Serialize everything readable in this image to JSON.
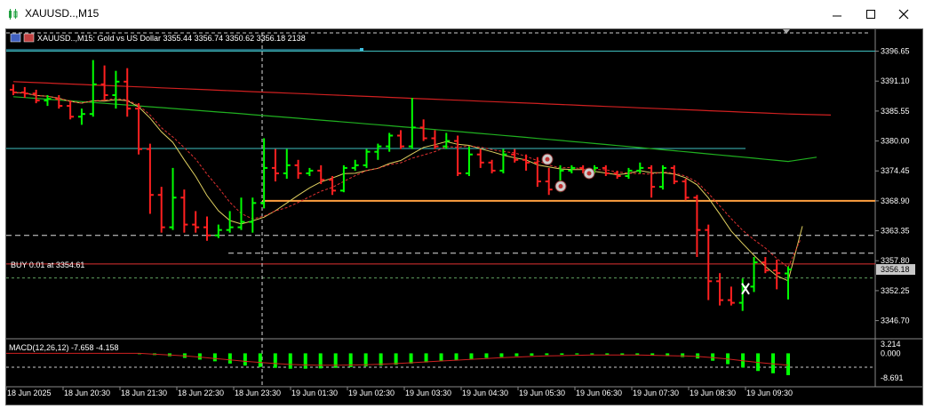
{
  "window": {
    "title": "XAUUSD..,M15",
    "minimize_icon": "minimize-icon",
    "maximize_icon": "maximize-icon",
    "close_icon": "close-icon"
  },
  "chart_header": {
    "text": "XAUUSD..,M15:  Gold vs US Dollar  3355.44 3356.74 3350.62 3356.18  2138"
  },
  "position_label": "BUY 0.01 at 3354.61",
  "macd_label": "MACD(12,26,12) -7.658 -4.158",
  "colors": {
    "background": "#000000",
    "bull": "#00ff00",
    "bear": "#ff2020",
    "grid": "#ffffff",
    "hline_cyan": "#40c0c0",
    "orange_line": "#ffa040",
    "ma_red": "#d02020",
    "ma_green": "#20b020",
    "ma_yellow": "#e0d060"
  },
  "chart_data": {
    "type": "candlestick",
    "title": "XAUUSD..,M15",
    "price_axis_ticks": [
      "3396.65",
      "3391.10",
      "3385.55",
      "3380.00",
      "3374.45",
      "3368.90",
      "3363.35",
      "3357.80",
      "3352.25",
      "3346.70"
    ],
    "price_axis_range": [
      3343.5,
      3400.2
    ],
    "current_price": "3356.18",
    "position_price": 3354.61,
    "horizontal_levels": [
      3396.65,
      3378.6,
      3368.9,
      3362.5,
      3359.2,
      3357.2
    ],
    "time_axis_labels": [
      "18 Jun 2025",
      "18 Jun 20:30",
      "18 Jun 21:30",
      "18 Jun 22:30",
      "18 Jun 23:30",
      "19 Jun 01:30",
      "19 Jun 02:30",
      "19 Jun 03:30",
      "19 Jun 04:30",
      "19 Jun 05:30",
      "19 Jun 06:30",
      "19 Jun 07:30",
      "19 Jun 08:30",
      "19 Jun 09:30"
    ],
    "candles": [
      [
        3389.5,
        3390.5,
        3388.5,
        3389.0
      ],
      [
        3389.0,
        3390.0,
        3388.0,
        3388.8
      ],
      [
        3388.8,
        3389.5,
        3387.0,
        3387.5
      ],
      [
        3387.5,
        3388.5,
        3386.5,
        3387.8
      ],
      [
        3387.8,
        3388.5,
        3386.0,
        3386.5
      ],
      [
        3386.5,
        3387.5,
        3384.0,
        3384.5
      ],
      [
        3384.5,
        3386.0,
        3383.0,
        3385.0
      ],
      [
        3385.0,
        3395.0,
        3384.5,
        3390.5
      ],
      [
        3390.5,
        3394.0,
        3387.5,
        3388.5
      ],
      [
        3388.5,
        3393.0,
        3386.0,
        3391.0
      ],
      [
        3391.0,
        3393.5,
        3384.5,
        3386.0
      ],
      [
        3386.0,
        3387.0,
        3377.5,
        3378.5
      ],
      [
        3378.5,
        3379.5,
        3366.5,
        3370.0
      ],
      [
        3370.0,
        3371.5,
        3363.0,
        3364.0
      ],
      [
        3364.0,
        3375.0,
        3363.5,
        3369.5
      ],
      [
        3369.5,
        3371.0,
        3363.0,
        3364.5
      ],
      [
        3364.5,
        3367.0,
        3363.0,
        3364.0
      ],
      [
        3364.0,
        3366.0,
        3361.5,
        3362.5
      ],
      [
        3362.5,
        3364.5,
        3362.0,
        3363.5
      ],
      [
        3363.5,
        3367.0,
        3363.0,
        3364.0
      ],
      [
        3364.0,
        3369.5,
        3363.5,
        3365.0
      ],
      [
        3365.0,
        3369.5,
        3363.0,
        3368.5
      ],
      [
        3368.5,
        3380.5,
        3367.5,
        3375.0
      ],
      [
        3375.0,
        3378.5,
        3372.5,
        3374.0
      ],
      [
        3374.0,
        3378.5,
        3373.0,
        3375.5
      ],
      [
        3375.5,
        3376.5,
        3373.0,
        3374.0
      ],
      [
        3374.0,
        3375.0,
        3373.5,
        3374.5
      ],
      [
        3374.5,
        3375.5,
        3372.0,
        3372.8
      ],
      [
        3372.8,
        3373.5,
        3370.0,
        3370.8
      ],
      [
        3370.8,
        3375.5,
        3370.5,
        3375.0
      ],
      [
        3375.0,
        3376.5,
        3374.5,
        3375.5
      ],
      [
        3375.5,
        3378.5,
        3375.0,
        3378.0
      ],
      [
        3378.0,
        3379.5,
        3376.5,
        3379.0
      ],
      [
        3379.0,
        3381.5,
        3378.0,
        3381.0
      ],
      [
        3381.0,
        3382.0,
        3378.5,
        3379.0
      ],
      [
        3379.0,
        3388.0,
        3378.5,
        3382.5
      ],
      [
        3382.5,
        3384.0,
        3380.0,
        3380.5
      ],
      [
        3380.5,
        3382.0,
        3378.5,
        3379.0
      ],
      [
        3379.0,
        3381.5,
        3378.5,
        3380.0
      ],
      [
        3380.0,
        3381.0,
        3373.5,
        3374.0
      ],
      [
        3374.0,
        3379.0,
        3373.5,
        3377.5
      ],
      [
        3377.5,
        3378.5,
        3375.0,
        3376.0
      ],
      [
        3376.0,
        3376.5,
        3374.0,
        3374.5
      ],
      [
        3374.5,
        3378.5,
        3374.0,
        3377.5
      ],
      [
        3377.5,
        3378.5,
        3376.0,
        3376.5
      ],
      [
        3376.5,
        3377.5,
        3374.5,
        3376.0
      ],
      [
        3376.0,
        3377.0,
        3371.5,
        3372.5
      ],
      [
        3372.5,
        3375.0,
        3370.0,
        3371.0
      ],
      [
        3371.0,
        3375.5,
        3370.5,
        3374.5
      ],
      [
        3374.5,
        3375.5,
        3374.0,
        3375.0
      ],
      [
        3375.0,
        3375.5,
        3374.0,
        3374.5
      ],
      [
        3374.5,
        3375.5,
        3374.0,
        3375.0
      ],
      [
        3375.0,
        3375.5,
        3373.5,
        3374.0
      ],
      [
        3374.0,
        3374.5,
        3373.0,
        3373.5
      ],
      [
        3373.5,
        3375.0,
        3373.0,
        3374.5
      ],
      [
        3374.5,
        3376.0,
        3374.0,
        3375.0
      ],
      [
        3375.0,
        3375.5,
        3369.5,
        3371.5
      ],
      [
        3371.5,
        3375.5,
        3371.0,
        3375.0
      ],
      [
        3375.0,
        3375.5,
        3372.0,
        3372.5
      ],
      [
        3372.5,
        3373.0,
        3369.0,
        3369.5
      ],
      [
        3369.5,
        3370.0,
        3358.5,
        3363.5
      ],
      [
        3363.5,
        3364.5,
        3350.5,
        3354.0
      ],
      [
        3354.0,
        3355.5,
        3349.5,
        3350.5
      ],
      [
        3350.5,
        3353.0,
        3349.5,
        3350.0
      ],
      [
        3350.0,
        3354.5,
        3348.5,
        3353.0
      ],
      [
        3353.0,
        3358.5,
        3352.0,
        3357.5
      ],
      [
        3357.5,
        3358.5,
        3355.5,
        3356.0
      ],
      [
        3356.0,
        3358.0,
        3352.5,
        3355.5
      ],
      [
        3355.44,
        3356.74,
        3350.62,
        3356.18
      ]
    ],
    "macd_axis_ticks": [
      "3.214",
      "0.000",
      "-8.691"
    ],
    "macd_range": [
      -10.5,
      4.5
    ],
    "macd_histogram": [
      -0.3,
      -0.6,
      -1.0,
      -1.6,
      -2.2,
      -2.8,
      -3.6,
      -4.3,
      -4.8,
      -5.1,
      -5.4,
      -5.4,
      -5.3,
      -5.1,
      -4.8,
      -4.6,
      -4.3,
      -4.0,
      -3.6,
      -3.2,
      -2.8,
      -2.4,
      -2.0,
      -1.6,
      -1.3,
      -1.0,
      -0.8,
      -0.6,
      -0.5,
      -0.4,
      -0.4,
      -0.5,
      -0.6,
      -0.7,
      -0.8,
      -1.0,
      -1.3,
      -1.8,
      -2.6,
      -3.8,
      -5.0,
      -6.2,
      -7.0,
      -7.66
    ],
    "macd_signal": [
      0.0,
      -0.3,
      -0.6,
      -0.9,
      -1.3,
      -1.8,
      -2.3,
      -2.8,
      -3.2,
      -3.6,
      -3.9,
      -4.1,
      -4.2,
      -4.2,
      -4.1,
      -4.0,
      -3.8,
      -3.6,
      -3.3,
      -3.0,
      -2.7,
      -2.4,
      -2.1,
      -1.8,
      -1.5,
      -1.3,
      -1.1,
      -0.9,
      -0.8,
      -0.7,
      -0.6,
      -0.6,
      -0.6,
      -0.6,
      -0.7,
      -0.8,
      -0.9,
      -1.1,
      -1.5,
      -2.0,
      -2.6,
      -3.2,
      -3.7,
      -4.158
    ]
  }
}
